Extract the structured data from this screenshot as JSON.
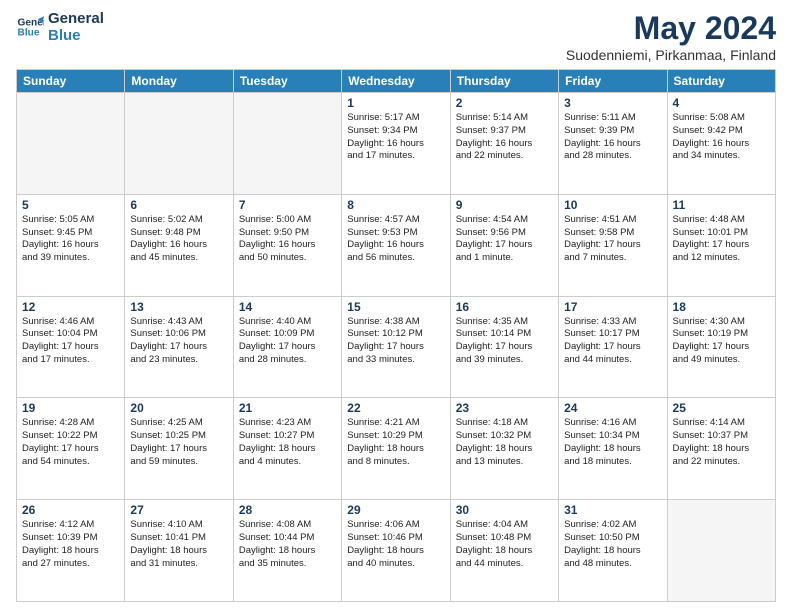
{
  "logo": {
    "line1": "General",
    "line2": "Blue"
  },
  "title": "May 2024",
  "subtitle": "Suodenniemi, Pirkanmaa, Finland",
  "days": [
    "Sunday",
    "Monday",
    "Tuesday",
    "Wednesday",
    "Thursday",
    "Friday",
    "Saturday"
  ],
  "cells": [
    {
      "day": "",
      "content": ""
    },
    {
      "day": "",
      "content": ""
    },
    {
      "day": "",
      "content": ""
    },
    {
      "day": "1",
      "content": "Sunrise: 5:17 AM\nSunset: 9:34 PM\nDaylight: 16 hours\nand 17 minutes."
    },
    {
      "day": "2",
      "content": "Sunrise: 5:14 AM\nSunset: 9:37 PM\nDaylight: 16 hours\nand 22 minutes."
    },
    {
      "day": "3",
      "content": "Sunrise: 5:11 AM\nSunset: 9:39 PM\nDaylight: 16 hours\nand 28 minutes."
    },
    {
      "day": "4",
      "content": "Sunrise: 5:08 AM\nSunset: 9:42 PM\nDaylight: 16 hours\nand 34 minutes."
    },
    {
      "day": "5",
      "content": "Sunrise: 5:05 AM\nSunset: 9:45 PM\nDaylight: 16 hours\nand 39 minutes."
    },
    {
      "day": "6",
      "content": "Sunrise: 5:02 AM\nSunset: 9:48 PM\nDaylight: 16 hours\nand 45 minutes."
    },
    {
      "day": "7",
      "content": "Sunrise: 5:00 AM\nSunset: 9:50 PM\nDaylight: 16 hours\nand 50 minutes."
    },
    {
      "day": "8",
      "content": "Sunrise: 4:57 AM\nSunset: 9:53 PM\nDaylight: 16 hours\nand 56 minutes."
    },
    {
      "day": "9",
      "content": "Sunrise: 4:54 AM\nSunset: 9:56 PM\nDaylight: 17 hours\nand 1 minute."
    },
    {
      "day": "10",
      "content": "Sunrise: 4:51 AM\nSunset: 9:58 PM\nDaylight: 17 hours\nand 7 minutes."
    },
    {
      "day": "11",
      "content": "Sunrise: 4:48 AM\nSunset: 10:01 PM\nDaylight: 17 hours\nand 12 minutes."
    },
    {
      "day": "12",
      "content": "Sunrise: 4:46 AM\nSunset: 10:04 PM\nDaylight: 17 hours\nand 17 minutes."
    },
    {
      "day": "13",
      "content": "Sunrise: 4:43 AM\nSunset: 10:06 PM\nDaylight: 17 hours\nand 23 minutes."
    },
    {
      "day": "14",
      "content": "Sunrise: 4:40 AM\nSunset: 10:09 PM\nDaylight: 17 hours\nand 28 minutes."
    },
    {
      "day": "15",
      "content": "Sunrise: 4:38 AM\nSunset: 10:12 PM\nDaylight: 17 hours\nand 33 minutes."
    },
    {
      "day": "16",
      "content": "Sunrise: 4:35 AM\nSunset: 10:14 PM\nDaylight: 17 hours\nand 39 minutes."
    },
    {
      "day": "17",
      "content": "Sunrise: 4:33 AM\nSunset: 10:17 PM\nDaylight: 17 hours\nand 44 minutes."
    },
    {
      "day": "18",
      "content": "Sunrise: 4:30 AM\nSunset: 10:19 PM\nDaylight: 17 hours\nand 49 minutes."
    },
    {
      "day": "19",
      "content": "Sunrise: 4:28 AM\nSunset: 10:22 PM\nDaylight: 17 hours\nand 54 minutes."
    },
    {
      "day": "20",
      "content": "Sunrise: 4:25 AM\nSunset: 10:25 PM\nDaylight: 17 hours\nand 59 minutes."
    },
    {
      "day": "21",
      "content": "Sunrise: 4:23 AM\nSunset: 10:27 PM\nDaylight: 18 hours\nand 4 minutes."
    },
    {
      "day": "22",
      "content": "Sunrise: 4:21 AM\nSunset: 10:29 PM\nDaylight: 18 hours\nand 8 minutes."
    },
    {
      "day": "23",
      "content": "Sunrise: 4:18 AM\nSunset: 10:32 PM\nDaylight: 18 hours\nand 13 minutes."
    },
    {
      "day": "24",
      "content": "Sunrise: 4:16 AM\nSunset: 10:34 PM\nDaylight: 18 hours\nand 18 minutes."
    },
    {
      "day": "25",
      "content": "Sunrise: 4:14 AM\nSunset: 10:37 PM\nDaylight: 18 hours\nand 22 minutes."
    },
    {
      "day": "26",
      "content": "Sunrise: 4:12 AM\nSunset: 10:39 PM\nDaylight: 18 hours\nand 27 minutes."
    },
    {
      "day": "27",
      "content": "Sunrise: 4:10 AM\nSunset: 10:41 PM\nDaylight: 18 hours\nand 31 minutes."
    },
    {
      "day": "28",
      "content": "Sunrise: 4:08 AM\nSunset: 10:44 PM\nDaylight: 18 hours\nand 35 minutes."
    },
    {
      "day": "29",
      "content": "Sunrise: 4:06 AM\nSunset: 10:46 PM\nDaylight: 18 hours\nand 40 minutes."
    },
    {
      "day": "30",
      "content": "Sunrise: 4:04 AM\nSunset: 10:48 PM\nDaylight: 18 hours\nand 44 minutes."
    },
    {
      "day": "31",
      "content": "Sunrise: 4:02 AM\nSunset: 10:50 PM\nDaylight: 18 hours\nand 48 minutes."
    },
    {
      "day": "",
      "content": ""
    }
  ]
}
